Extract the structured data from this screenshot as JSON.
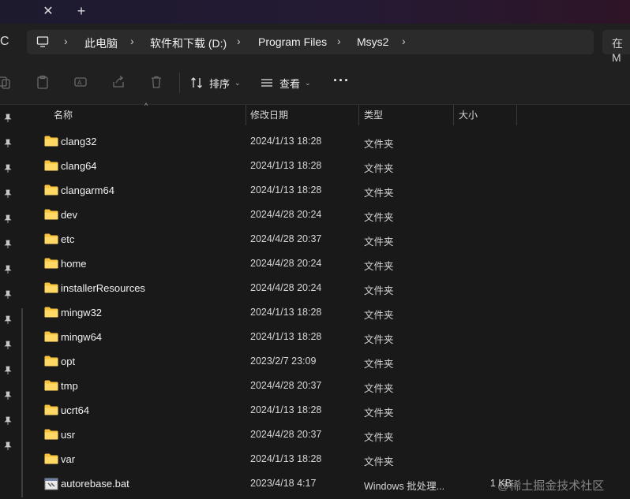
{
  "tabbar": {
    "close_glyph": "✕",
    "new_tab_glyph": "+"
  },
  "addressbar": {
    "refresh_glyph": "C",
    "breadcrumbs": [
      "此电脑",
      "软件和下载 (D:)",
      "Program Files",
      "Msys2"
    ],
    "separator": "›",
    "search_placeholder": "在 M"
  },
  "toolbar": {
    "sort_label": "排序",
    "view_label": "查看",
    "more_glyph": "···",
    "dropdown_glyph": "⌄"
  },
  "columns": {
    "name": "名称",
    "date": "修改日期",
    "type": "类型",
    "size": "大小"
  },
  "files": [
    {
      "name": "clang32",
      "date": "2024/1/13 18:28",
      "type": "文件夹",
      "size": "",
      "icon": "folder-icon"
    },
    {
      "name": "clang64",
      "date": "2024/1/13 18:28",
      "type": "文件夹",
      "size": "",
      "icon": "folder-icon"
    },
    {
      "name": "clangarm64",
      "date": "2024/1/13 18:28",
      "type": "文件夹",
      "size": "",
      "icon": "folder-icon"
    },
    {
      "name": "dev",
      "date": "2024/4/28 20:24",
      "type": "文件夹",
      "size": "",
      "icon": "folder-icon"
    },
    {
      "name": "etc",
      "date": "2024/4/28 20:37",
      "type": "文件夹",
      "size": "",
      "icon": "folder-icon"
    },
    {
      "name": "home",
      "date": "2024/4/28 20:24",
      "type": "文件夹",
      "size": "",
      "icon": "folder-icon"
    },
    {
      "name": "installerResources",
      "date": "2024/4/28 20:24",
      "type": "文件夹",
      "size": "",
      "icon": "folder-icon"
    },
    {
      "name": "mingw32",
      "date": "2024/1/13 18:28",
      "type": "文件夹",
      "size": "",
      "icon": "folder-icon"
    },
    {
      "name": "mingw64",
      "date": "2024/1/13 18:28",
      "type": "文件夹",
      "size": "",
      "icon": "folder-icon"
    },
    {
      "name": "opt",
      "date": "2023/2/7 23:09",
      "type": "文件夹",
      "size": "",
      "icon": "folder-icon"
    },
    {
      "name": "tmp",
      "date": "2024/4/28 20:37",
      "type": "文件夹",
      "size": "",
      "icon": "folder-icon"
    },
    {
      "name": "ucrt64",
      "date": "2024/1/13 18:28",
      "type": "文件夹",
      "size": "",
      "icon": "folder-icon"
    },
    {
      "name": "usr",
      "date": "2024/4/28 20:37",
      "type": "文件夹",
      "size": "",
      "icon": "folder-icon"
    },
    {
      "name": "var",
      "date": "2024/1/13 18:28",
      "type": "文件夹",
      "size": "",
      "icon": "folder-icon"
    },
    {
      "name": "autorebase.bat",
      "date": "2023/4/18 4:17",
      "type": "Windows 批处理...",
      "size": "1 KB",
      "icon": "batch-file-icon"
    }
  ],
  "watermark": "@稀土掘金技术社区",
  "colors": {
    "folder": "#f7c33b",
    "background": "#191919",
    "toolbar": "#202020"
  }
}
